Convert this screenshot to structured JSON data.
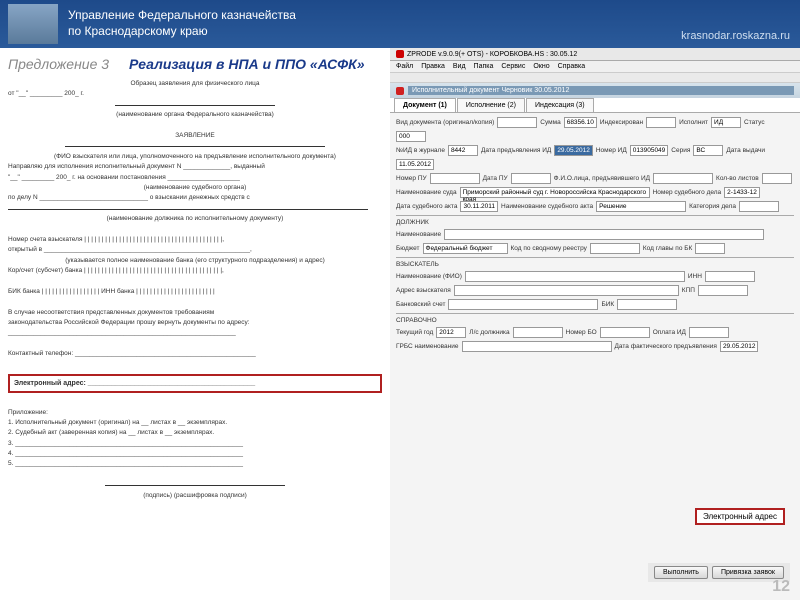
{
  "header": {
    "line1": "Управление Федерального казначейства",
    "line2": "по Краснодарскому краю",
    "url": "krasnodar.roskazna.ru"
  },
  "title": {
    "pred": "Предложение 3",
    "real": "Реализация в НПА и ППО «АСФК»"
  },
  "doc": {
    "sample": "Образец заявления для физического лица",
    "from": "от \"__\" _________ 200_ г.",
    "orgHint": "(наименование органа Федерального казначейства)",
    "zay": "ЗАЯВЛЕНИЕ",
    "fioHint": "(ФИО взыскателя или лица, уполномоченного на предъявление исполнительного документа)",
    "l1": "Направляю для исполнения исполнительный документ N _____________, выданный",
    "l2": "\"__\" _________ 200_ г. на основании постановления ____________________",
    "sudHint": "(наименование судебного органа)",
    "l3": "по делу N ______________________________ о взыскании денежных средств с",
    "debtHint": "(наименование должника по исполнительному документу)",
    "acc1": "Номер счета взыскателя | | | | | | | | | | | | | | | | | | | | | | | | | | | | | | | | | | | | | | | |,",
    "acc2": "открытый в _________________________________________________________,",
    "bankHint": "(указывается полное наименование банка (его структурного подразделения) и адрес)",
    "kor": "Кор/счет (субсчет) банка | | | | | | | | | | | | | | | | | | | | | | | | | | | | | | | | | | | | | | | |,",
    "bik": "БИК банка | | | | | | | | | | | | | | | | |  ИНН банка | | | | | | | | | | | | | | | | | | | | | | |",
    "ret1": "В случае несоответствия представленных документов требованиям",
    "ret2": "законодательства Российской Федерации прошу вернуть документы по адресу:",
    "ret3": "_______________________________________________________________",
    "phone": "Контактный телефон: __________________________________________________",
    "email": "Электронный адрес: ___________________________________________",
    "att": "Приложение:",
    "a1": "1. Исполнительный документ (оригинал) на __ листах в __ экземплярах.",
    "a2": "2. Судебный акт (заверенная копия) на __ листах в __ экземплярах.",
    "a3": "3. _______________________________________________________________",
    "a4": "4. _______________________________________________________________",
    "a5": "5. _______________________________________________________________",
    "sig": "(подпись)     (расшифровка подписи)"
  },
  "app": {
    "title": "ZPRODE v.9.0.9(+ OTS) - КОРОБКОВА.НS : 30.05.12",
    "menu": [
      "Файл",
      "Правка",
      "Вид",
      "Папка",
      "Сервис",
      "Окно",
      "Справка"
    ],
    "subtitle": "Исполнительный документ Черновик 30.05.2012",
    "tabs": [
      "Документ (1)",
      "Исполнение (2)",
      "Индексация (3)"
    ],
    "f": {
      "vid": "Вид документа (оригинал/копия)",
      "summa": "Сумма",
      "summaV": "68356.10",
      "index": "Индексирован",
      "ispol": "Исполнит",
      "ispolV": "ИД",
      "status": "Статус",
      "statusV": "000",
      "nidj": "№ИД в журнале",
      "nidjV": "8442",
      "dpred": "Дата предъявления ИД",
      "dpredV": "29.05.2012",
      "nid": "Номер ИД",
      "nidV": "013905049",
      "ser": "Серия",
      "serV": "ВС",
      "dvyd": "Дата выдачи",
      "dvydV": "11.05.2012",
      "npu": "Номер ПУ",
      "dpu": "Дата ПУ",
      "fio": "Ф.И.О.лица, предъявившего ИД",
      "kolvo": "Кол-во листов",
      "sud": "Наименование суда",
      "sudV": "Приморский районный суд г. Новороссийска Краснодарского края",
      "nsd": "Номер судебного дела",
      "nsdV": "2-1433-12",
      "dsud": "Дата судебного акта",
      "dsudV": "30.11.2011",
      "naimSud": "Наименование судебного акта",
      "naimSudV": "Решение",
      "kat": "Категория дела",
      "dolj": "ДОЛЖНИК",
      "naim": "Наименование",
      "budj": "Бюджет",
      "budjV": "Федеральный бюджет",
      "ksr": "Код по сводному реестру",
      "kgbk": "Код главы по БК",
      "vzys": "ВЗЫСКАТЕЛЬ",
      "vfio": "Наименование (ФИО)",
      "inn": "ИНН",
      "adr": "Адрес взыскателя",
      "kpp": "КПП",
      "bank": "Банковский счет",
      "bik": "БИК",
      "sprav": "СПРАВОЧНО",
      "email2": "Электронный адрес",
      "tg": "Текущий год",
      "tgV": "2012",
      "lsd": "Л/с должника",
      "nbo": "Номер БО",
      "opl": "Оплата ИД",
      "grbs": "ГРБС наименование",
      "dfp": "Дата фактического предъявления",
      "dfpV": "29.05.2012"
    },
    "btns": {
      "ok": "Выполнить",
      "bind": "Привязка заявок"
    }
  },
  "page": "12"
}
